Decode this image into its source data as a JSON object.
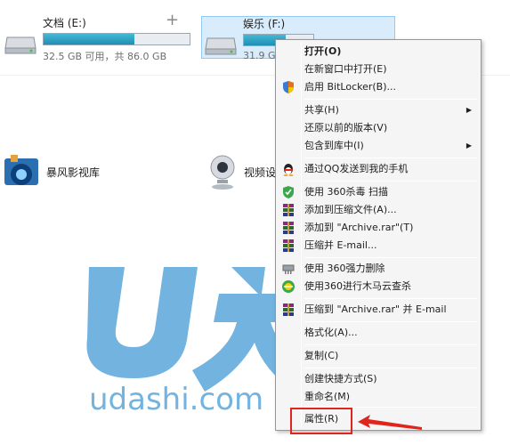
{
  "drives": [
    {
      "name": "文档 (E:)",
      "size_text": "32.5 GB 可用，共 86.0 GB",
      "used_fraction": 0.62
    },
    {
      "name": "娱乐 (F:)",
      "size_text": "31.9 GB",
      "used_fraction": 0.6
    }
  ],
  "libraries": [
    {
      "name": "暴风影视库"
    },
    {
      "name": "视频设"
    }
  ],
  "watermark": {
    "text": "udashi.com"
  },
  "context_menu": {
    "items": [
      {
        "label": "打开(O)"
      },
      {
        "label": "在新窗口中打开(E)"
      },
      {
        "label": "启用 BitLocker(B)..."
      },
      {
        "label": "共享(H)"
      },
      {
        "label": "还原以前的版本(V)"
      },
      {
        "label": "包含到库中(I)"
      },
      {
        "label": "通过QQ发送到我的手机"
      },
      {
        "label": "使用 360杀毒 扫描"
      },
      {
        "label": "添加到压缩文件(A)..."
      },
      {
        "label": "添加到 \"Archive.rar\"(T)"
      },
      {
        "label": "压缩并 E-mail..."
      },
      {
        "label": "使用 360强力删除"
      },
      {
        "label": "使用360进行木马云查杀"
      },
      {
        "label": "压缩到 \"Archive.rar\" 并 E-mail"
      },
      {
        "label": "格式化(A)..."
      },
      {
        "label": "复制(C)"
      },
      {
        "label": "创建快捷方式(S)"
      },
      {
        "label": "重命名(M)"
      },
      {
        "label": "属性(R)"
      }
    ]
  },
  "colors": {
    "accent_red": "#e0251b",
    "watermark_blue": "#5aa6da",
    "bar_fill": "#1f8eb5"
  }
}
